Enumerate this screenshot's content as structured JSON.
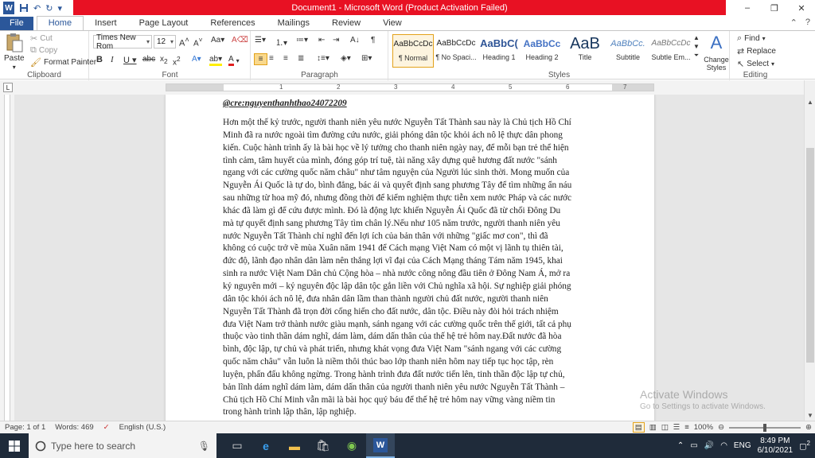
{
  "titlebar": {
    "title": "Document1 - Microsoft Word (Product Activation Failed)",
    "qat_icons": [
      "word-icon",
      "save-icon",
      "undo-icon",
      "redo-icon",
      "customize-icon"
    ]
  },
  "window_controls": {
    "minimize": "–",
    "restore": "❐",
    "close": "✕"
  },
  "tabs": [
    "File",
    "Home",
    "Insert",
    "Page Layout",
    "References",
    "Mailings",
    "Review",
    "View"
  ],
  "active_tab": "Home",
  "clipboard": {
    "label": "Clipboard",
    "paste": "Paste",
    "cut": "Cut",
    "copy": "Copy",
    "format_painter": "Format Painter"
  },
  "font": {
    "label": "Font",
    "family": "Times New Rom",
    "size": "12"
  },
  "paragraph": {
    "label": "Paragraph"
  },
  "styles": {
    "label": "Styles",
    "items": [
      {
        "sample": "AaBbCcDc",
        "name": "¶ Normal"
      },
      {
        "sample": "AaBbCcDc",
        "name": "¶ No Spaci..."
      },
      {
        "sample": "AaBbC(",
        "name": "Heading 1"
      },
      {
        "sample": "AaBbCc",
        "name": "Heading 2"
      },
      {
        "sample": "AaB",
        "name": "Title"
      },
      {
        "sample": "AaBbCc.",
        "name": "Subtitle"
      },
      {
        "sample": "AaBbCcDc",
        "name": "Subtle Em..."
      }
    ],
    "change_styles": "Change Styles"
  },
  "editing": {
    "label": "Editing",
    "find": "Find",
    "replace": "Replace",
    "select": "Select"
  },
  "ruler": {
    "numbers": [
      "1",
      "2",
      "3",
      "4",
      "5",
      "6",
      "7"
    ]
  },
  "document": {
    "handle": "@cre:nguyenthanhthao24072209",
    "lines": [
      "Hơn một thế kỷ trước, người thanh niên yêu nước Nguyễn Tất Thành sau này là Chủ tịch Hồ Chí",
      "Minh đã ra nước ngoài tìm đường cứu nước, giải phóng dân tộc khỏi ách nô lệ thực dân phong",
      "kiến. Cuộc hành trình ấy là bài học về lý tưởng cho thanh niên ngày nay, để mỗi bạn trẻ thể hiện",
      "tình cảm, tâm huyết của mình, đóng góp trí tuệ, tài năng xây dựng quê hương đất nước \"sánh",
      "ngang với các cường quốc năm châu\" như tâm nguyện của Người lúc sinh thời. Mong muốn của",
      "Nguyễn Ái Quốc là tự do, bình đẳng, bác ái và quyết định sang phương Tây để tìm những ẩn náu",
      "sau những từ hoa mỹ đó, nhưng đồng thời để kiểm nghiệm thực tiễn xem nước Pháp và các nước",
      "khác đã làm gì để cứu được mình. Đó là động lực khiến Nguyễn Ái Quốc đã từ chối Đông Du",
      "mà tự quyết định sang phương Tây tìm chân lý.Nếu như 105 năm trước, người thanh niên yêu",
      "nước Nguyễn Tất Thành chỉ nghĩ đến lợi ích của bản thân với những \"giấc mơ con\", thì đã",
      "không có cuộc trở về mùa Xuân năm 1941 để Cách mạng Việt Nam có một vị lãnh tụ thiên tài,",
      "đức độ, lãnh đạo nhân dân làm nên thắng lợi vĩ đại của Cách Mạng tháng Tám năm 1945, khai",
      "sinh ra nước Việt Nam Dân chủ Cộng hòa – nhà nước công nông đầu tiên ở Đông Nam Á, mở ra",
      "kỷ nguyên mới – kỷ nguyên độc lập dân tộc gắn liền với Chủ nghĩa xã hội. Sự nghiệp giải phóng",
      "dân tộc khỏi ách nô lệ, đưa nhân dân lầm than thành người chủ đất nước, người thanh niên",
      "Nguyễn Tất Thành đã trọn đời cống hiến cho đất nước, dân tộc. Điều này đòi hỏi trách nhiệm",
      "đưa Việt Nam trở thành nước giàu mạnh, sánh ngang với các cường quốc trên thế giới, tất cả phụ",
      "thuộc vào tinh thần dám nghĩ, dám làm, dám dấn thân của thế hệ trẻ hôm nay.Đất nước đã hòa",
      "bình, độc lập, tự chủ và phát triển, nhưng khát vọng đưa Việt Nam \"sánh ngang với các cường",
      "quốc năm châu\" vẫn luôn là niềm thôi thúc bao lớp thanh niên hôm nay tiếp tục học tập, rèn",
      "luyện, phấn đấu không ngừng. Trong hành trình đưa đất nước tiến lên, tinh thần độc lập tự chủ,",
      "bản lĩnh dám nghĩ dám làm, dám dấn thân của người thanh niên yêu nước Nguyễn Tất Thành –",
      "Chủ tịch Hồ Chí Minh vẫn mãi là bài học quý báu để thế hệ trẻ hôm nay vững vàng niềm tin",
      "trong hành trình lập thân, lập nghiệp."
    ]
  },
  "watermark": {
    "line1": "Activate Windows",
    "line2": "Go to Settings to activate Windows."
  },
  "status": {
    "page": "Page: 1 of 1",
    "words": "Words: 469",
    "language": "English (U.S.)",
    "zoom": "100%"
  },
  "taskbar": {
    "search_placeholder": "Type here to search",
    "language": "ENG",
    "time": "8:49 PM",
    "date": "6/10/2021",
    "notification_count": "2"
  }
}
